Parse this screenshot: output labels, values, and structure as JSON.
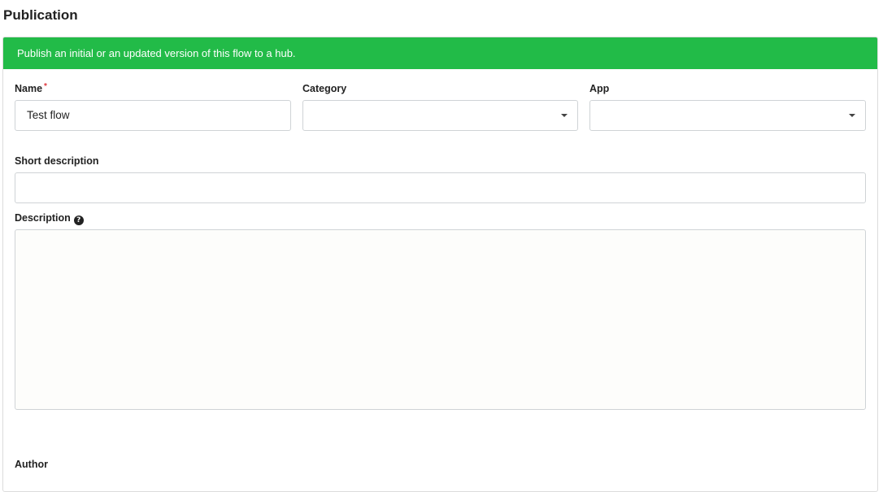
{
  "page": {
    "title": "Publication"
  },
  "banner": {
    "text": "Publish an initial or an updated version of this flow to a hub."
  },
  "form": {
    "name": {
      "label": "Name",
      "required_marker": "*",
      "value": "Test flow"
    },
    "category": {
      "label": "Category",
      "value": ""
    },
    "app": {
      "label": "App",
      "value": ""
    },
    "short_description": {
      "label": "Short description",
      "value": ""
    },
    "description": {
      "label": "Description",
      "help_icon_glyph": "?",
      "value": ""
    },
    "author": {
      "label": "Author"
    }
  },
  "colors": {
    "banner_background": "#22bb48",
    "required_marker": "#e0383e"
  },
  "icons": {
    "dropdown": "caret-down-icon",
    "help": "question-circle-icon"
  }
}
